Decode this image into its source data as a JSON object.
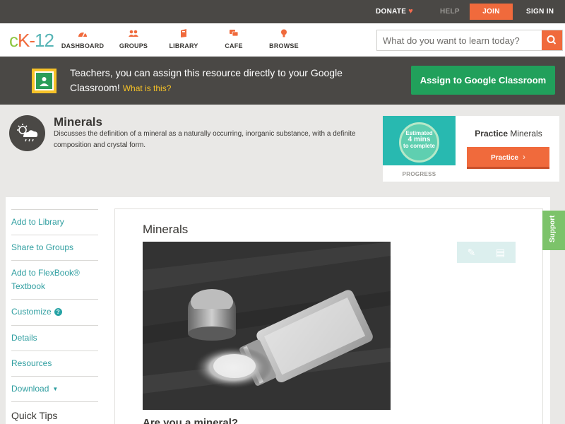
{
  "topbar": {
    "donate": "DONATE",
    "help": "HELP",
    "join": "JOIN",
    "signin": "SIGN IN"
  },
  "logo": {
    "c": "c",
    "k": "K",
    "dash": "-",
    "num": "12"
  },
  "nav": [
    {
      "label": "DASHBOARD",
      "icon": "dashboard-icon"
    },
    {
      "label": "GROUPS",
      "icon": "groups-icon"
    },
    {
      "label": "LIBRARY",
      "icon": "library-icon"
    },
    {
      "label": "CAFE",
      "icon": "cafe-icon"
    },
    {
      "label": "BROWSE",
      "icon": "browse-icon"
    }
  ],
  "search": {
    "placeholder": "What do you want to learn today?"
  },
  "classroom": {
    "text": "Teachers, you can assign this resource directly to your Google Classroom!",
    "what": "What is this?",
    "button": "Assign to Google Classroom"
  },
  "lesson": {
    "title": "Minerals",
    "description": "Discusses the definition of a mineral as a naturally occurring, inorganic substance, with a definite composition and crystal form."
  },
  "practice": {
    "estimated": "Estimated",
    "mins": "4 mins",
    "to_complete": "to complete",
    "progress_label": "PROGRESS",
    "title_bold": "Practice",
    "title_rest": "Minerals",
    "button": "Practice"
  },
  "sidebar": {
    "items": [
      "Add to Library",
      "Share to Groups",
      "Add to FlexBook® Textbook",
      "Customize",
      "Details",
      "Resources",
      "Download"
    ],
    "help_glyph": "?",
    "quick_tips": "Quick Tips"
  },
  "content": {
    "title": "Minerals",
    "subheading": "Are you a mineral?"
  },
  "support": "Support",
  "colors": {
    "brand_orange": "#f06a3c",
    "teal": "#2f9ea0",
    "classroom_green": "#21a05b",
    "support_green": "#7cc36a"
  }
}
